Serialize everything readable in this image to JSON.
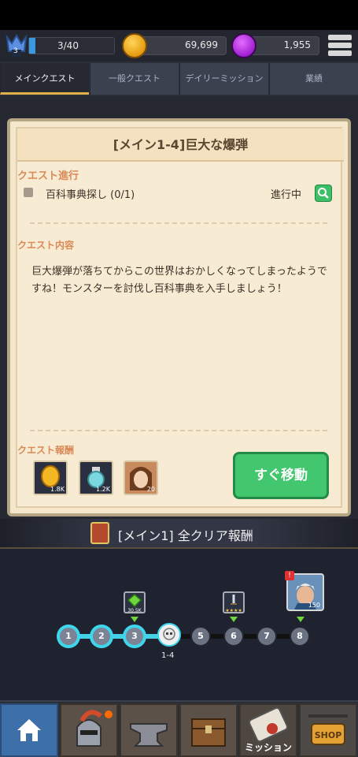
{
  "resources": {
    "level_badge": "3",
    "stamina": "3/40",
    "coins": "69,699",
    "gems": "1,955"
  },
  "tabs": [
    "メインクエスト",
    "一般クエスト",
    "デイリーミッション",
    "業績"
  ],
  "quest": {
    "title": "[メイン1-4]巨大な爆弾",
    "progress_label": "クエスト進行",
    "task": "百科事典探し (0/1)",
    "status": "進行中",
    "content_label": "クエスト内容",
    "description": "巨大爆弾が落ちてからこの世界はおかしくなってしまったようですね！モンスターを討伐し百科事典を入手しましょう！",
    "rewards_label": "クエスト報酬",
    "rewards": [
      {
        "icon": "coin-icon",
        "amount": "1.8K"
      },
      {
        "icon": "potion-icon",
        "amount": "1.2K"
      },
      {
        "icon": "hero-portrait-icon",
        "amount": "20"
      }
    ],
    "go_button": "すぐ移動"
  },
  "all_clear": {
    "label": "[メイン1] 全クリア報酬"
  },
  "stages": {
    "nodes": [
      "1",
      "2",
      "3",
      "5",
      "6",
      "7",
      "8"
    ],
    "current_label": "1-4",
    "item_stage3_amount": "30.5K",
    "item_stage6_stars": "★★★★",
    "boss_amount": "150",
    "boss_badge": "!"
  },
  "nav": {
    "mission_label": "ミッション",
    "shop_label": "SHOP"
  },
  "colors": {
    "accent_gold": "#e0b148",
    "go_green": "#42c76f",
    "track_active": "#43d2e6",
    "section_label": "#d98a56"
  }
}
